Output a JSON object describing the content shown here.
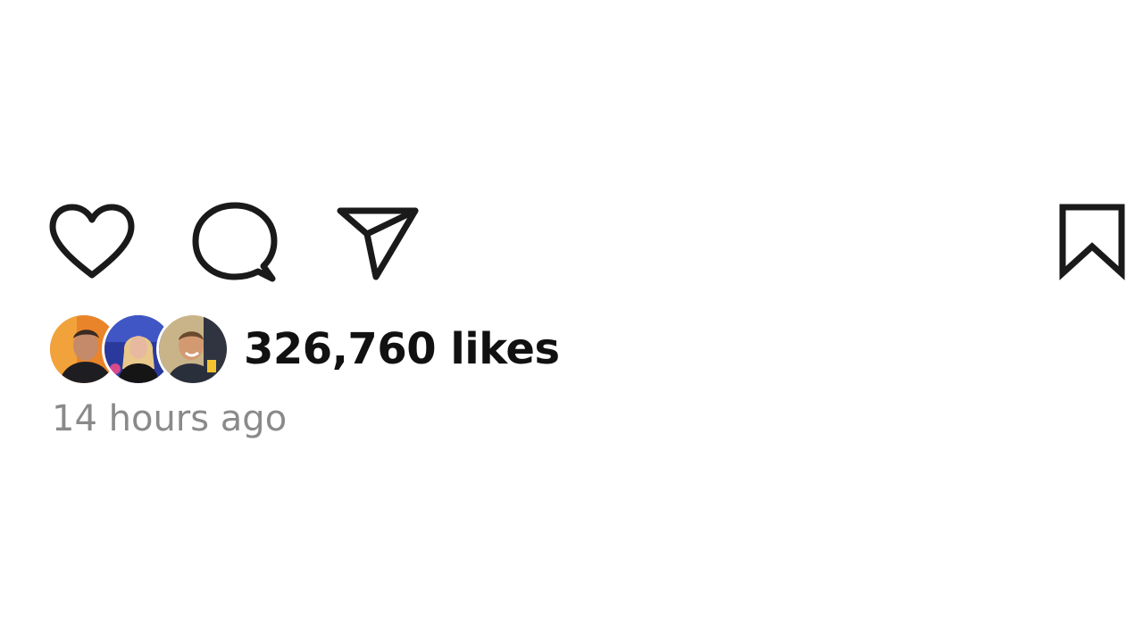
{
  "actions": {
    "like_icon": "heart-icon",
    "comment_icon": "speech-bubble-icon",
    "share_icon": "paper-plane-icon",
    "save_icon": "bookmark-icon"
  },
  "likes": {
    "count": "326,760",
    "suffix": "likes",
    "avatars": [
      {
        "icon": "avatar-photo",
        "bg": "#e9842a"
      },
      {
        "icon": "avatar-photo",
        "bg": "#2a3a9c"
      },
      {
        "icon": "avatar-photo",
        "bg": "#c9b48a"
      }
    ]
  },
  "meta": {
    "time_ago": "14 hours ago"
  },
  "colors": {
    "text": "#111111",
    "muted": "#8a8a8a",
    "icon_stroke": "#1a1a1a"
  }
}
